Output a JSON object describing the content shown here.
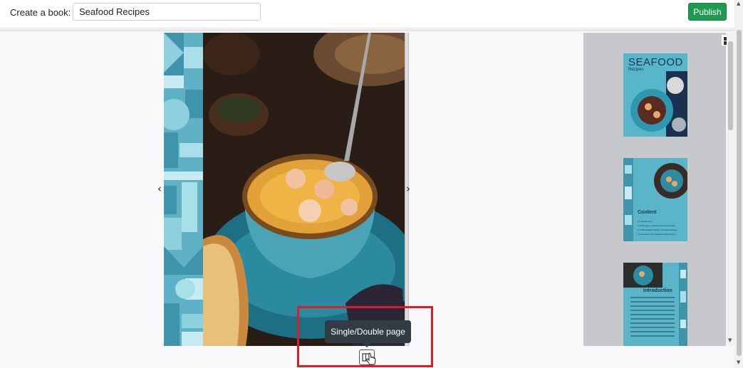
{
  "toolbar": {
    "create_label": "Create a book:",
    "book_title_value": "Seafood Recipes",
    "publish_label": "Publish"
  },
  "viewer": {
    "tooltip": "Single/Double page",
    "prev_arrow": "‹",
    "next_arrow": "›"
  },
  "thumbnails": [
    {
      "title": "SEAFOOD",
      "subtitle": "Recipes"
    },
    {
      "title": "Content",
      "items": [
        "1.1 Introduction",
        "2.1 Ecology in a Seafood Sauce Recipe",
        "3.1 Wild-Caught Shrimp Tomatoes Recipe",
        "4.1 Seasonal Cod Seafood Stew Recipe"
      ]
    },
    {
      "title": "Introduction"
    }
  ],
  "colors": {
    "publish": "#1f9a52",
    "highlight": "#d81f28",
    "tooltip_bg": "#313c45",
    "pattern": "#5fb2c6"
  },
  "icons": [
    "grid-view-icon",
    "book-page-icon",
    "hand-pointer-icon",
    "chevron-left-icon",
    "chevron-right-icon"
  ]
}
